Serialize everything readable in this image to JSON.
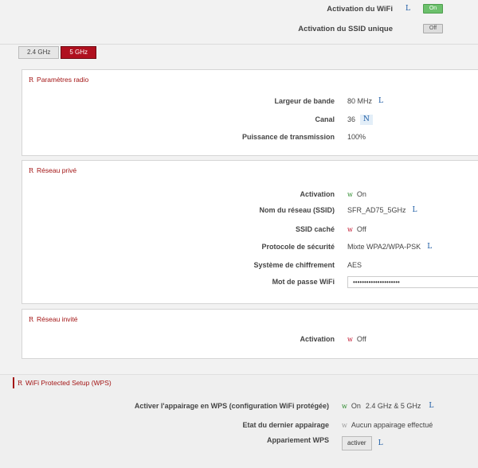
{
  "top": {
    "wifi_activation": {
      "label": "Activation du WiFi",
      "state": "On",
      "icon": "L"
    },
    "ssid_unique": {
      "label": "Activation du SSID unique",
      "state": "Off"
    }
  },
  "tabs": [
    {
      "label": "2.4 GHz",
      "active": false
    },
    {
      "label": "5 GHz",
      "active": true
    }
  ],
  "radio": {
    "title": "Paramètres radio",
    "bandwidth": {
      "label": "Largeur de bande",
      "value": "80 MHz",
      "icon": "L"
    },
    "channel": {
      "label": "Canal",
      "value": "36",
      "icon": "N"
    },
    "power": {
      "label": "Puissance de transmission",
      "value": "100%"
    }
  },
  "private": {
    "title": "Réseau privé",
    "activation": {
      "label": "Activation",
      "value": "On",
      "icon": "w"
    },
    "ssid": {
      "label": "Nom du réseau (SSID)",
      "value": "SFR_AD75_5GHz",
      "icon": "L"
    },
    "hidden": {
      "label": "SSID caché",
      "value": "Off",
      "icon": "w"
    },
    "security": {
      "label": "Protocole de sécurité",
      "value": "Mixte WPA2/WPA-PSK",
      "icon": "L"
    },
    "cipher": {
      "label": "Système de chiffrement",
      "value": "AES"
    },
    "password": {
      "label": "Mot de passe WiFi",
      "value": "•••••••••••••••••••••"
    }
  },
  "guest": {
    "title": "Réseau invité",
    "activation": {
      "label": "Activation",
      "value": "Off",
      "icon": "w"
    }
  },
  "wps": {
    "title": "WiFi Protected Setup (WPS)",
    "enable": {
      "label": "Activer l'appairage en WPS (configuration WiFi protégée)",
      "value": "On",
      "bands": "2.4 GHz & 5 GHz",
      "icon": "w",
      "icon2": "L"
    },
    "last": {
      "label": "Etat du dernier appairage",
      "value": "Aucun appairage effectué",
      "icon": "w"
    },
    "pairing": {
      "label": "Appariement WPS",
      "button": "activer",
      "icon": "L"
    }
  },
  "section_icon": "R"
}
